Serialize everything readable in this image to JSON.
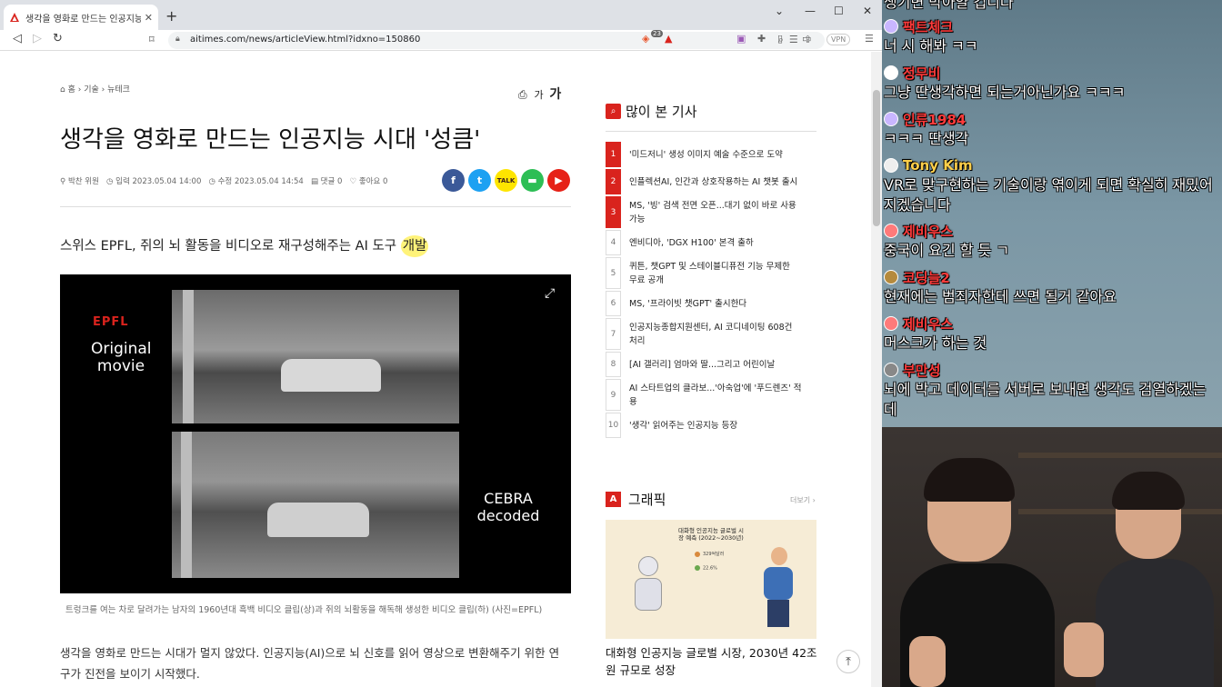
{
  "browser": {
    "tab_title": "생각을 영화로 만드는 인공지능 /",
    "url": "aitimes.com/news/articleView.html?idxno=150860",
    "vpn_label": "VPN",
    "ext_badge": "23"
  },
  "article": {
    "breadcrumb": [
      "홈",
      "기술",
      "뉴테크"
    ],
    "font_small": "가",
    "font_large": "가",
    "title": "생각을 영화로 만드는 인공지능 시대 '성큼'",
    "author": "박찬 위원",
    "published": "입력 2023.05.04 14:00",
    "modified": "수정 2023.05.04 14:54",
    "comments": "댓글 0",
    "likes": "좋아요 0",
    "subtitle_main": "스위스 EPFL, 쥐의 뇌 활동을 비디오로 재구성해주는 AI 도구 ",
    "subtitle_highlight": "개발",
    "video": {
      "brand": "EPFL",
      "left_label": "Original movie",
      "right_label": "CEBRA decoded"
    },
    "caption": "트렁크를 여는 차로 달려가는 남자의 1960년대 흑백 비디오 클립(상)과 쥐의 뇌활동을 해독해 생성한 비디오 클립(하) (사진=EPFL)",
    "body_line1": "생각을 영화로 만드는 시대가 멀지 않았다. 인공지능(AI)으로 뇌 신호를 읽어 영상으로 변환해주기 위한 연",
    "body_line2": "구가 진전을 보이기 시작했다."
  },
  "sidebar": {
    "popular_title": "많이 본 기사",
    "popular": [
      {
        "rank": "1",
        "lines": [
          "'미드저니' 생성 이미지 예술 수준으로 도약"
        ]
      },
      {
        "rank": "2",
        "lines": [
          "인플렉션AI, 인간과 상호작용하는 AI 챗봇 출시"
        ]
      },
      {
        "rank": "3",
        "lines": [
          "MS, '빙' 검색 전면 오픈...대기 없이 바로 사용",
          "가능"
        ]
      },
      {
        "rank": "4",
        "lines": [
          "엔비디아, 'DGX H100' 본격 출하"
        ]
      },
      {
        "rank": "5",
        "lines": [
          "퀴튼, 챗GPT 및 스테이블디퓨전 기능 무제한",
          "무료 공개"
        ]
      },
      {
        "rank": "6",
        "lines": [
          "MS, '프라이빗 챗GPT' 출시한다"
        ]
      },
      {
        "rank": "7",
        "lines": [
          "인공지능종합지원센터, AI 코디네이팅 608건",
          "처리"
        ]
      },
      {
        "rank": "8",
        "lines": [
          "[AI 갤러리] 엄마와 딸...그리고 어린이날"
        ]
      },
      {
        "rank": "9",
        "lines": [
          "AI 스타트업의 클라보...'아숙업'에 '푸드렌즈' 적",
          "용"
        ]
      },
      {
        "rank": "10",
        "lines": [
          "'생각' 읽어주는 인공지능 등장"
        ]
      }
    ],
    "graphic_title": "그래픽",
    "more_label": "더보기",
    "graphic_image_title": "대화형 인공지능 글로벌 시장 예측 (2022~2030년)",
    "graphic_stats": [
      "329억달러",
      "22.6%"
    ],
    "graphic_caption": "대화형 인공지능 글로벌 시장, 2030년 42조원 규모로 성장"
  },
  "chat": [
    {
      "user": "",
      "text": "생기면 막아얄 겁니다",
      "red": false
    },
    {
      "user": "팩트체크",
      "text": "너 시 해봐 ㅋㅋ",
      "red": true
    },
    {
      "user": "정무비",
      "text": "그냥 딴생각하면 되는거아닌가요 ㅋㅋㅋ",
      "red": true
    },
    {
      "user": "인류1984",
      "text": "ㅋㅋㅋ 딴생각",
      "red": true
    },
    {
      "user": "Tony Kim",
      "text": "VR로 맞구현하는 기술이랑 엮이게 되면 확실히 재밌어 지겠습니다",
      "red": false
    },
    {
      "user": "제비우스",
      "text": "중국이 요긴 할 듯 ㄱ",
      "red": true
    },
    {
      "user": "코딩늘2",
      "text": "현재에는 범죄자한테 쓰면 될거 같아요",
      "red": true
    },
    {
      "user": "제비우스",
      "text": "머스크가 하는 것",
      "red": true
    },
    {
      "user": "부만성",
      "text": "뇌에 박고 데이터를 서버로 보내면 생각도 검열하겠는 데",
      "red": true
    }
  ]
}
